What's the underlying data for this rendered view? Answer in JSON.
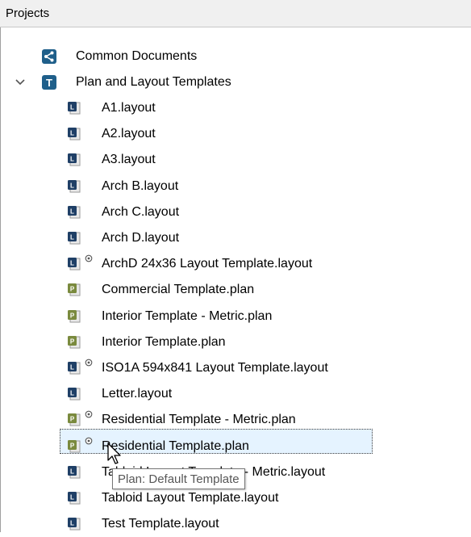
{
  "panel": {
    "title": "Projects"
  },
  "tree": {
    "root_items": [
      {
        "label": "Common Documents",
        "icon": "share-icon"
      },
      {
        "label": "Plan and Layout Templates",
        "icon": "template-folder-icon",
        "expanded": true
      }
    ],
    "children": [
      {
        "label": "A1.layout",
        "icon": "layout-file-icon",
        "default": false
      },
      {
        "label": "A2.layout",
        "icon": "layout-file-icon",
        "default": false
      },
      {
        "label": "A3.layout",
        "icon": "layout-file-icon",
        "default": false
      },
      {
        "label": "Arch B.layout",
        "icon": "layout-file-icon",
        "default": false
      },
      {
        "label": "Arch C.layout",
        "icon": "layout-file-icon",
        "default": false
      },
      {
        "label": "Arch D.layout",
        "icon": "layout-file-icon",
        "default": false
      },
      {
        "label": "ArchD 24x36 Layout Template.layout",
        "icon": "layout-file-icon",
        "default": true
      },
      {
        "label": "Commercial Template.plan",
        "icon": "plan-file-icon",
        "default": false
      },
      {
        "label": "Interior Template - Metric.plan",
        "icon": "plan-file-icon",
        "default": false
      },
      {
        "label": "Interior Template.plan",
        "icon": "plan-file-icon",
        "default": false
      },
      {
        "label": "ISO1A 594x841 Layout Template.layout",
        "icon": "layout-file-icon",
        "default": true
      },
      {
        "label": "Letter.layout",
        "icon": "layout-file-icon",
        "default": false
      },
      {
        "label": "Residential Template - Metric.plan",
        "icon": "plan-file-icon",
        "default": true
      },
      {
        "label": "Residential Template.plan",
        "icon": "plan-file-icon",
        "default": true,
        "selected": true
      },
      {
        "label": "Tabloid Layout Template - Metric.layout",
        "icon": "layout-file-icon",
        "default": false
      },
      {
        "label": "Tabloid Layout Template.layout",
        "icon": "layout-file-icon",
        "default": false
      },
      {
        "label": "Test Template.layout",
        "icon": "layout-file-icon",
        "default": false
      }
    ]
  },
  "tooltip": {
    "text": "Plan: Default Template"
  },
  "colors": {
    "header_bg": "#f0f0f0",
    "selection_bg": "#e5f3ff",
    "layout_icon": "#1f3f66",
    "plan_icon": "#7a8a3e",
    "root_icon": "#1f5f8a"
  }
}
